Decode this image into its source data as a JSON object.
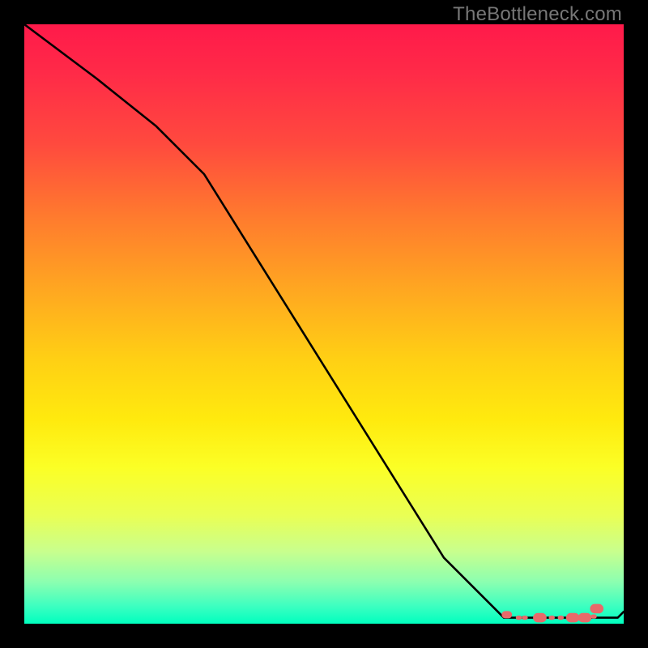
{
  "attribution": "TheBottleneck.com",
  "gradient_css": "linear-gradient(to bottom, #ff1a4a 0%, #ff2a48 8%, #ff4a3e 20%, #ff7a2e 32%, #ffa621 44%, #ffd014 56%, #ffea0e 66%, #fbff26 74%, #e9ff55 82%, #c8ff8e 88%, #8cffb0 93%, #3effc0 97%, #00ffbf 100%)",
  "chart_data": {
    "type": "line",
    "title": "",
    "xlabel": "",
    "ylabel": "",
    "xlim": [
      0,
      100
    ],
    "ylim": [
      0,
      100
    ],
    "series": [
      {
        "name": "main-curve",
        "color": "#000000",
        "x": [
          0,
          12,
          22,
          30,
          40,
          50,
          60,
          70,
          80,
          82,
          84,
          87,
          90,
          93,
          96,
          99,
          100
        ],
        "values": [
          100,
          91,
          83,
          75,
          59,
          43,
          27,
          11,
          1,
          1,
          1,
          1,
          1,
          1,
          1,
          1,
          2
        ]
      },
      {
        "name": "highlight-points",
        "color": "#e86a6a",
        "x": [
          80.5,
          82.5,
          83.5,
          86.0,
          88.0,
          89.5,
          91.5,
          93.5,
          95.0,
          95.5
        ],
        "values": [
          1.5,
          1.0,
          1.0,
          1.0,
          1.0,
          1.0,
          1.0,
          1.0,
          1.2,
          2.5
        ]
      }
    ],
    "highlight_marker_sizes": [
      3.5,
      2.0,
      2.0,
      4.5,
      2.0,
      2.0,
      4.5,
      4.5,
      2.0,
      4.5
    ]
  }
}
